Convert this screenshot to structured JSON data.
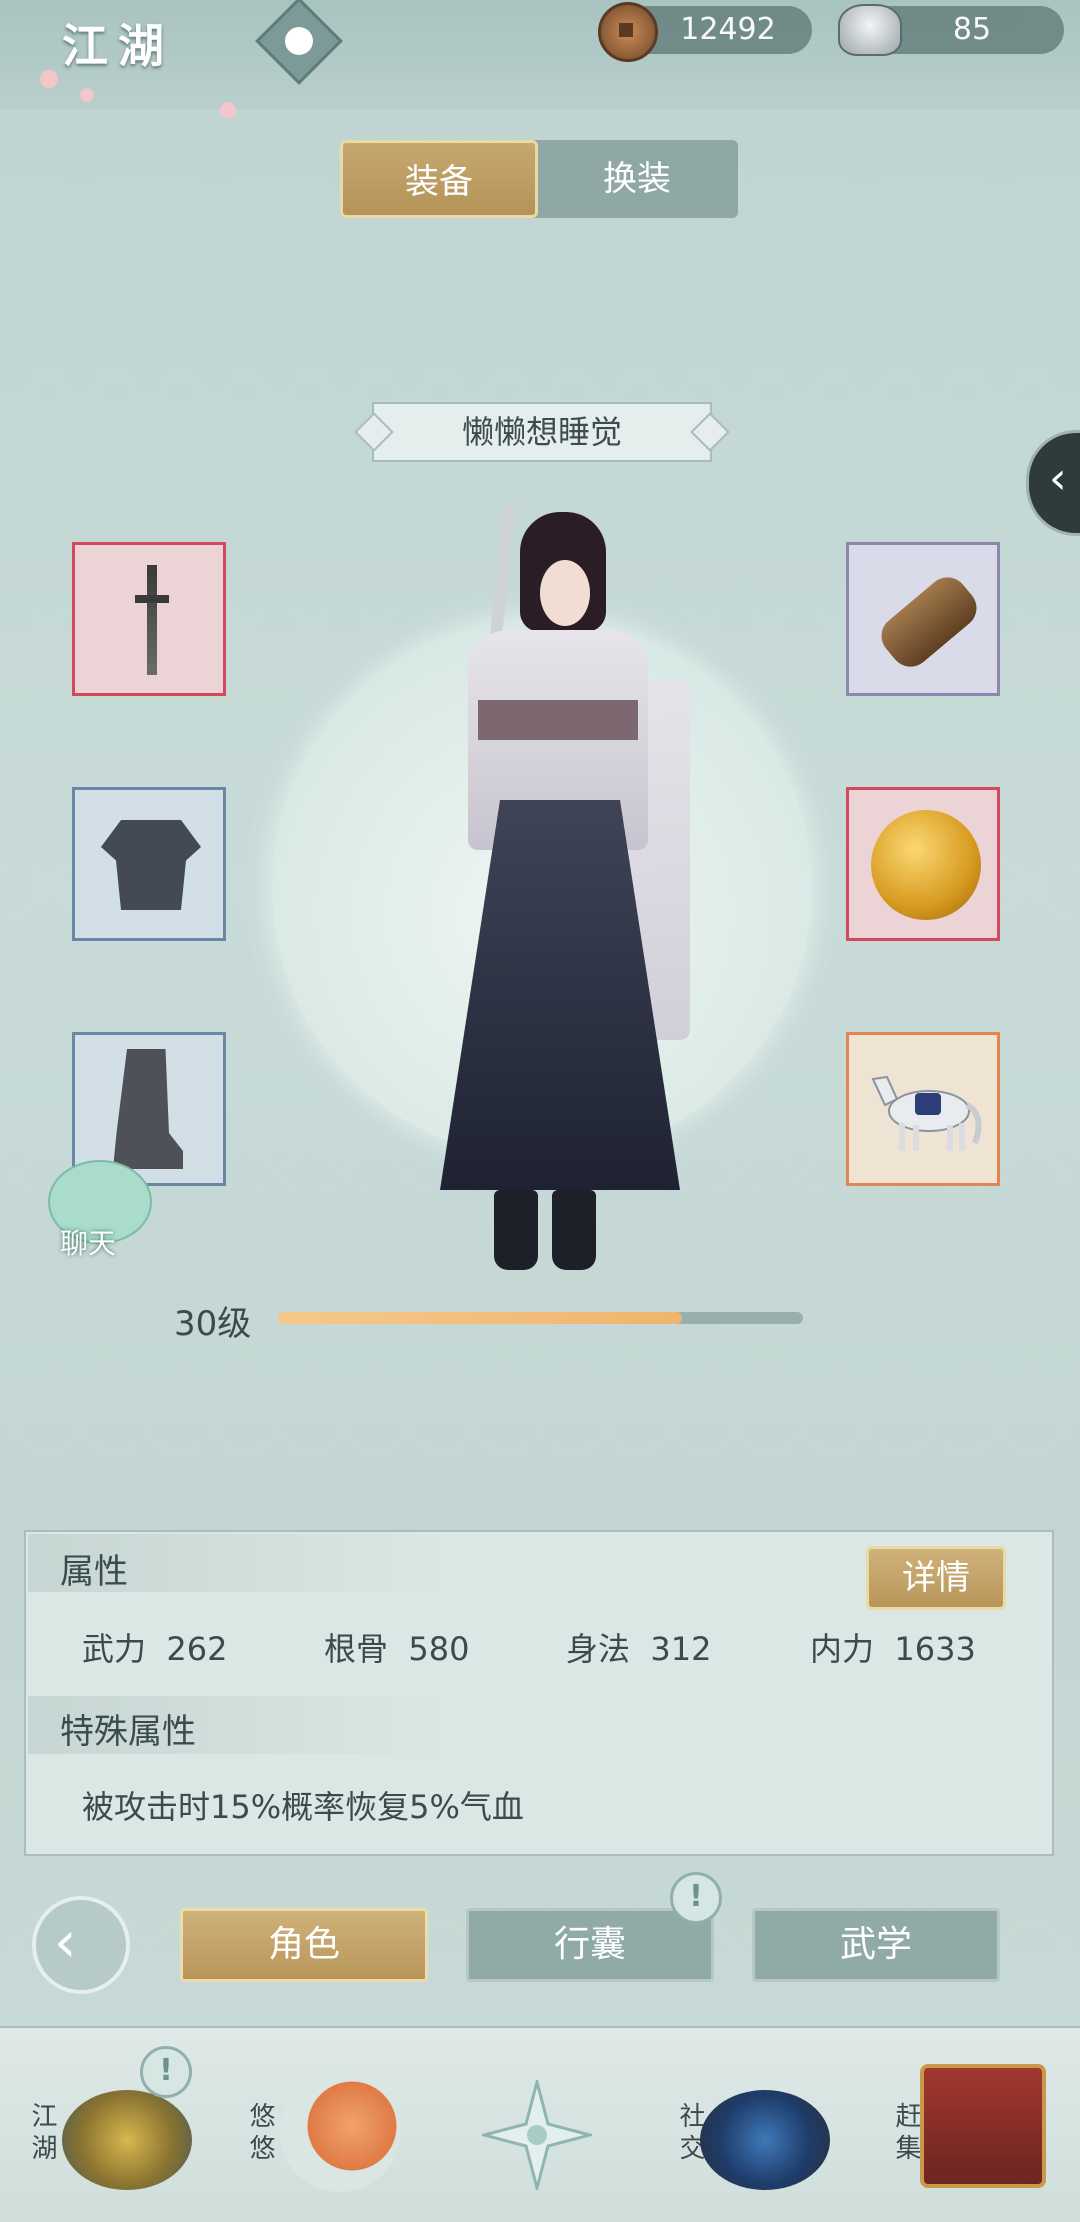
{
  "top_bar": {
    "region_title": "江湖",
    "copper_coins": "12492",
    "silver": "85"
  },
  "tabs": [
    {
      "label": "装备",
      "active": true
    },
    {
      "label": "换装",
      "active": false
    }
  ],
  "character": {
    "name": "懒懒想睡觉",
    "level_label": "30级",
    "level_progress_fraction": 0.77
  },
  "equipment": {
    "left": [
      "weapon-sword",
      "armor-shirt",
      "boots"
    ],
    "right": [
      "scroll-accessory",
      "amber-gem",
      "horse-mount"
    ]
  },
  "chat": {
    "label": "聊天"
  },
  "attributes": {
    "title": "属性",
    "detail_label": "详情",
    "stats": [
      {
        "name": "武力",
        "value": "262"
      },
      {
        "name": "根骨",
        "value": "580"
      },
      {
        "name": "身法",
        "value": "312"
      },
      {
        "name": "内力",
        "value": "1633"
      }
    ],
    "special_title": "特殊属性",
    "special_text": "被攻击时15%概率恢复5%气血"
  },
  "nav_tabs": [
    {
      "label": "角色",
      "active": true
    },
    {
      "label": "行囊",
      "active": false
    },
    {
      "label": "武学",
      "active": false
    }
  ],
  "dock": [
    {
      "label": "江湖"
    },
    {
      "label": "悠悠"
    },
    {
      "label": ""
    },
    {
      "label": "社交"
    },
    {
      "label": "赶集"
    }
  ],
  "colors": {
    "accent_gold": "#b8965a",
    "panel_teal": "#90aaa8",
    "progress": "#f0b46d"
  }
}
